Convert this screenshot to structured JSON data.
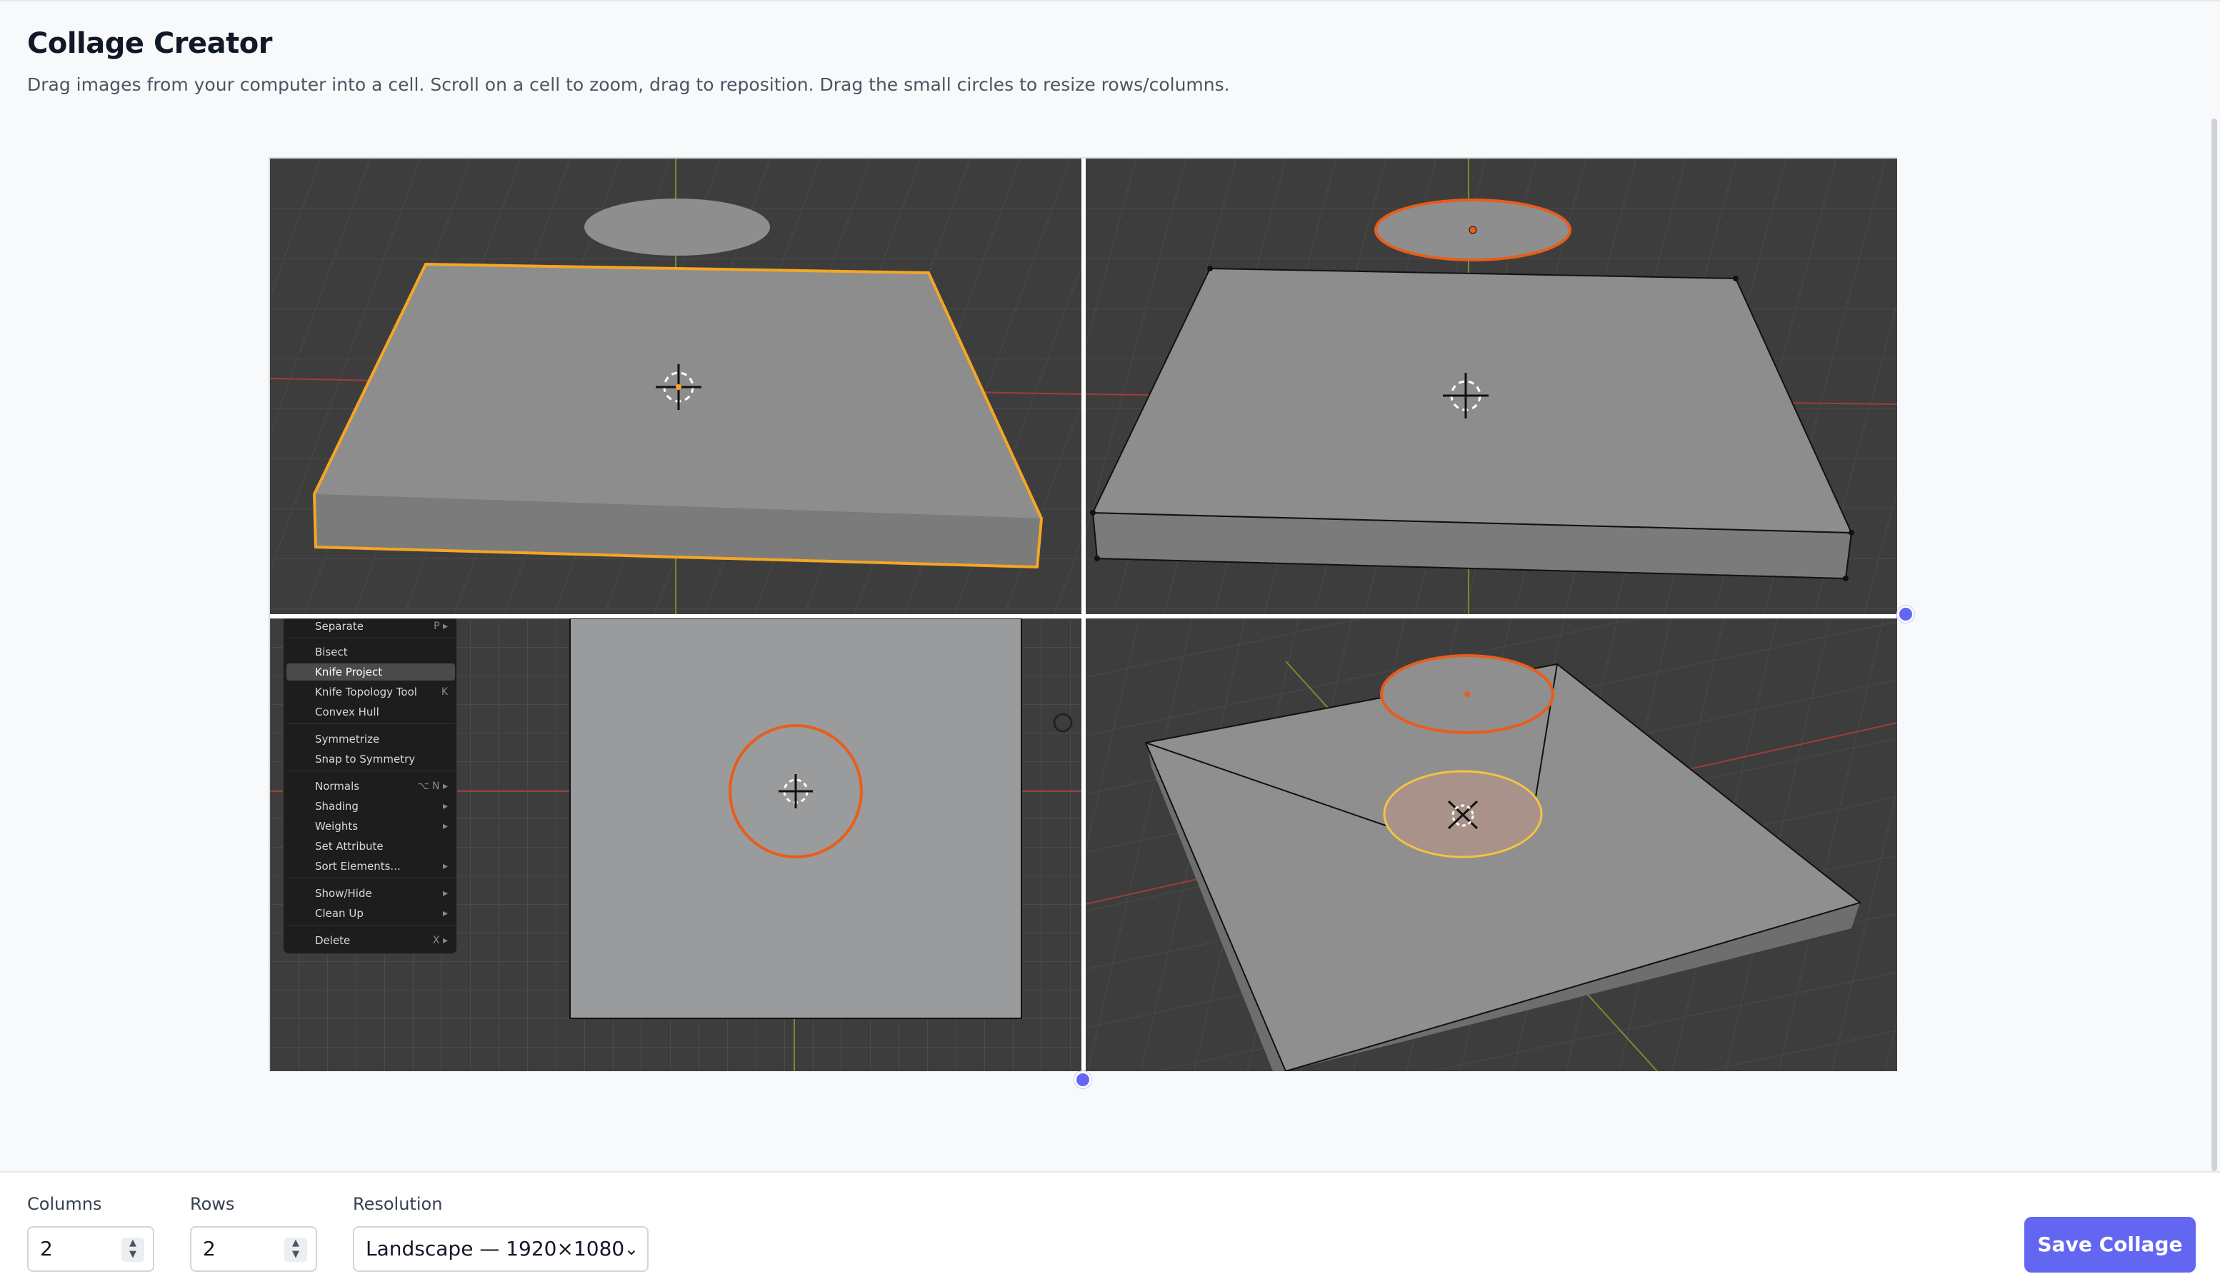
{
  "header": {
    "title": "Collage Creator",
    "subtitle": "Drag images from your computer into a cell. Scroll on a cell to zoom, drag to reposition. Drag the small circles to resize rows/columns."
  },
  "context_menu": {
    "items": [
      {
        "label": "Separate",
        "shortcut": "P ▸"
      },
      {
        "label": "Bisect",
        "shortcut": ""
      },
      {
        "label": "Knife Project",
        "shortcut": ""
      },
      {
        "label": "Knife Topology Tool",
        "shortcut": "K"
      },
      {
        "label": "Convex Hull",
        "shortcut": ""
      },
      {
        "label": "Symmetrize",
        "shortcut": ""
      },
      {
        "label": "Snap to Symmetry",
        "shortcut": ""
      },
      {
        "label": "Normals",
        "shortcut": "⌥ N ▸"
      },
      {
        "label": "Shading",
        "shortcut": "▸"
      },
      {
        "label": "Weights",
        "shortcut": "▸"
      },
      {
        "label": "Set Attribute",
        "shortcut": ""
      },
      {
        "label": "Sort Elements...",
        "shortcut": "▸"
      },
      {
        "label": "Show/Hide",
        "shortcut": "▸"
      },
      {
        "label": "Clean Up",
        "shortcut": "▸"
      },
      {
        "label": "Delete",
        "shortcut": "X ▸"
      }
    ],
    "active_item": "Knife Project"
  },
  "controls": {
    "columns_label": "Columns",
    "columns_value": "2",
    "rows_label": "Rows",
    "rows_value": "2",
    "resolution_label": "Resolution",
    "resolution_value": "Landscape — 1920×1080",
    "spinner_up": "▲",
    "spinner_down": "▼",
    "chevron": "⌄"
  },
  "save_button": {
    "label": "Save Collage"
  },
  "colors": {
    "accent": "#6366f1",
    "selection_orange": "#f5a623",
    "edit_orange": "#e85d1a",
    "viewport_bg": "#3d3d3d"
  }
}
